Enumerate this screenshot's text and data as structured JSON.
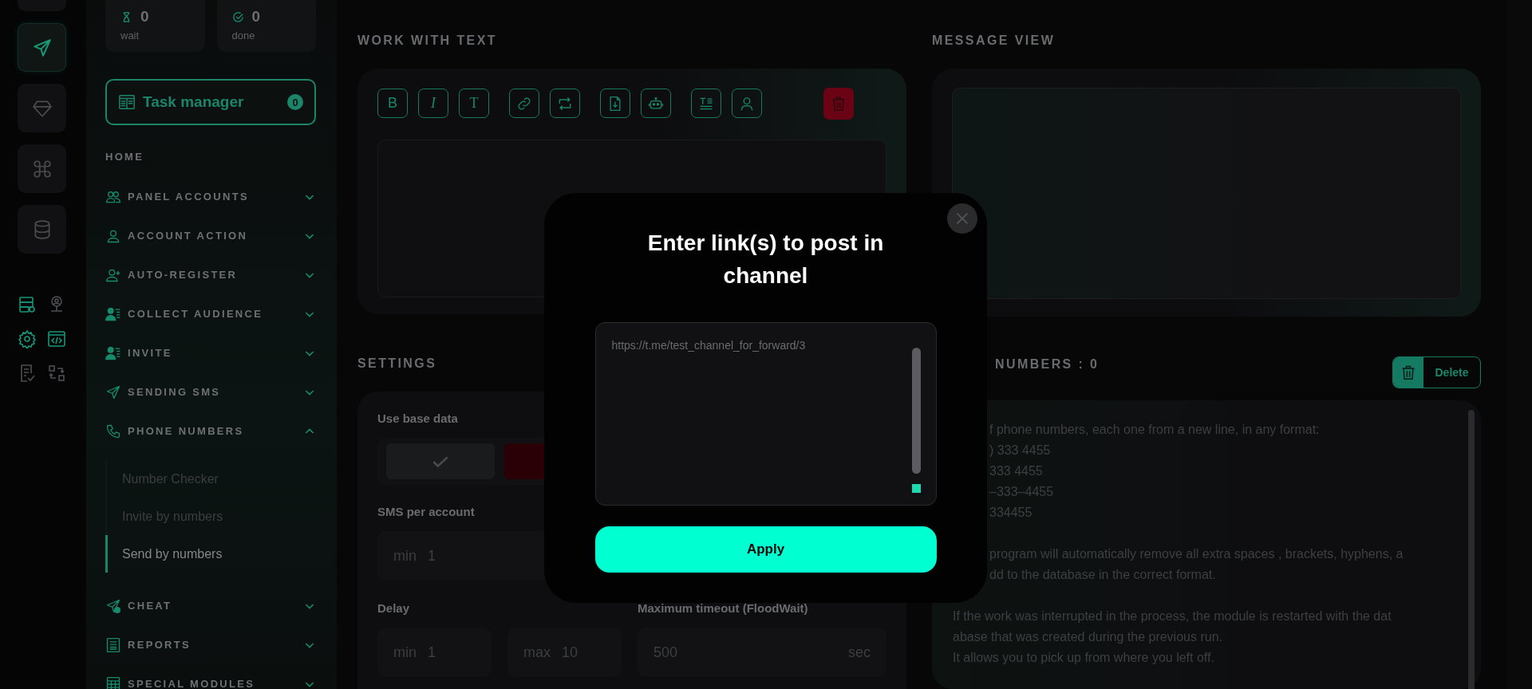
{
  "rail": {
    "buttons": [
      {
        "kind": "blank",
        "selected": false
      },
      {
        "kind": "send",
        "selected": true
      },
      {
        "kind": "diamond",
        "selected": false
      },
      {
        "kind": "command",
        "selected": false
      },
      {
        "kind": "database",
        "selected": false
      }
    ],
    "tools": [
      {
        "kind": "server",
        "active": true
      },
      {
        "kind": "user-pin",
        "active": false
      },
      {
        "kind": "gear",
        "active": true
      },
      {
        "kind": "code",
        "active": true
      },
      {
        "kind": "checklist",
        "active": false
      },
      {
        "kind": "swap",
        "active": false
      }
    ]
  },
  "stats": [
    {
      "kind": "hourglass",
      "value": "0",
      "label": "wait"
    },
    {
      "kind": "check",
      "value": "0",
      "label": "done"
    }
  ],
  "task_manager": {
    "label": "Task manager",
    "count": "0"
  },
  "nav": [
    {
      "kind": "heading",
      "label": "HOME"
    },
    {
      "kind": "group",
      "label": "PANEL ACCOUNTS",
      "expanded": false
    },
    {
      "kind": "group",
      "label": "ACCOUNT ACTION",
      "expanded": false
    },
    {
      "kind": "group",
      "label": "AUTO-REGISTER",
      "expanded": false
    },
    {
      "kind": "group",
      "label": "COLLECT AUDIENCE",
      "expanded": false
    },
    {
      "kind": "group",
      "label": "INVITE",
      "expanded": false
    },
    {
      "kind": "group",
      "label": "SENDING SMS",
      "expanded": false
    },
    {
      "kind": "group",
      "label": "PHONE NUMBERS",
      "expanded": true,
      "children": [
        {
          "label": "Number Checker",
          "selected": false
        },
        {
          "label": "Invite by numbers",
          "selected": false
        },
        {
          "label": "Send by numbers",
          "selected": true
        }
      ]
    },
    {
      "kind": "group",
      "label": "CHEAT",
      "expanded": false
    },
    {
      "kind": "group",
      "label": "REPORTS",
      "expanded": false
    },
    {
      "kind": "group",
      "label": "SPECIAL MODULES",
      "expanded": false
    }
  ],
  "editor": {
    "title": "WORK WITH TEXT",
    "tool_groups": [
      [
        {
          "kind": "glyph",
          "glyph": "B"
        },
        {
          "kind": "glyph-italic",
          "glyph": "I"
        },
        {
          "kind": "glyph-serif",
          "glyph": "T"
        }
      ],
      [
        {
          "kind": "link"
        },
        {
          "kind": "repeat"
        }
      ],
      [
        {
          "kind": "file"
        },
        {
          "kind": "robot"
        }
      ],
      [
        {
          "kind": "format"
        },
        {
          "kind": "user"
        }
      ]
    ]
  },
  "preview": {
    "title": "MESSAGE VIEW"
  },
  "settings": {
    "title": "SETTINGS",
    "use_base_data": {
      "label": "Use base data",
      "checked": false
    },
    "sms_per_account": {
      "label": "SMS per account",
      "prefix": "min",
      "value": "1"
    },
    "delay": {
      "label": "Delay",
      "fields": [
        {
          "prefix": "min",
          "value": "1"
        },
        {
          "prefix": "max",
          "value": "10"
        }
      ]
    },
    "timeout": {
      "label": "Maximum timeout (FloodWait)",
      "value": "500",
      "unit": "sec"
    }
  },
  "numbers": {
    "title": "NUMBERS : 0",
    "delete": "Delete",
    "paragraphs": [
      [
        {
          "text": "f phone numbers, each one from a new line, in any format:",
          "clipped": true
        },
        {
          "text": ") 333 4455",
          "clipped": true
        },
        {
          "text": "333 4455",
          "clipped": true
        },
        {
          "text": "–333–4455",
          "clipped": true
        },
        {
          "text": "334455",
          "clipped": true
        }
      ],
      [
        {
          "text": "program will automatically remove all extra spaces , brackets, hyphens, a",
          "clipped": true
        },
        {
          "text": "dd to the database in the correct format.",
          "clipped": true
        }
      ],
      [
        {
          "text": "If the work was interrupted in the process, the module is restarted with the dat",
          "clipped": false
        },
        {
          "text": "abase that was created during the previous run.",
          "clipped": false
        },
        {
          "text": "It allows you to pick up from where you left off.",
          "clipped": false
        }
      ]
    ]
  },
  "modal": {
    "title": "Enter link(s) to post in channel",
    "value": "https://t.me/test_channel_for_forward/3",
    "apply": "Apply"
  }
}
